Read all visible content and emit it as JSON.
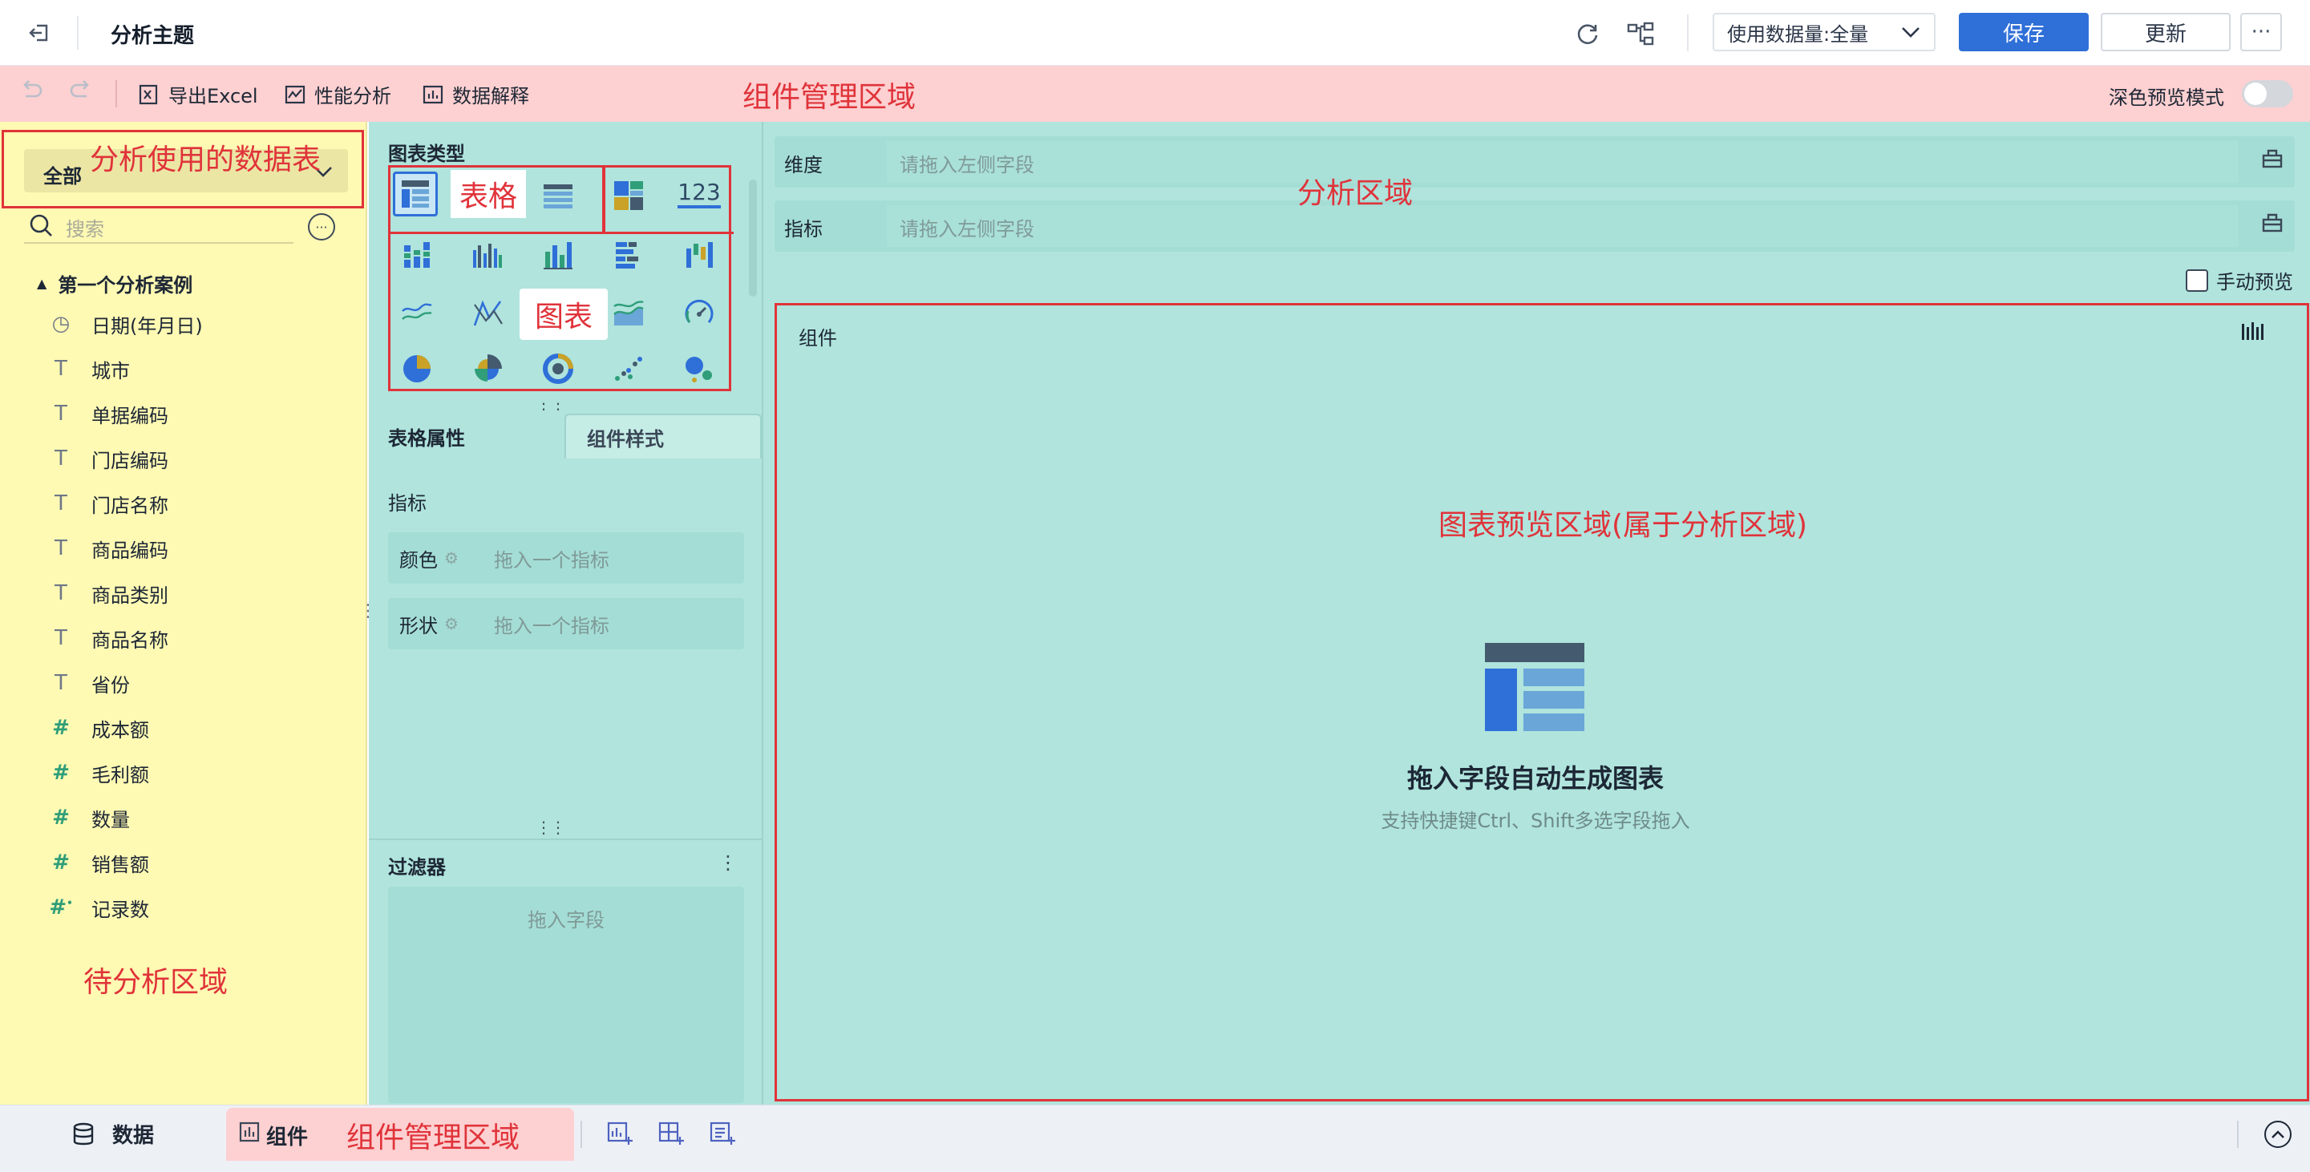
{
  "topbar": {
    "title": "分析主题",
    "data_amount_label": "使用数据量:全量",
    "save_label": "保存",
    "update_label": "更新",
    "more_label": "···"
  },
  "toolbar": {
    "export_label": "导出Excel",
    "performance_label": "性能分析",
    "explain_label": "数据解释",
    "annotation": "组件管理区域",
    "dark_mode_label": "深色预览模式"
  },
  "left": {
    "scope_label": "全部",
    "scope_annotation": "分析使用的数据表",
    "search_placeholder": "搜索",
    "group_label": "第一个分析案例",
    "fields": [
      {
        "icon": "clock",
        "label": "日期(年月日)"
      },
      {
        "icon": "text",
        "label": "城市"
      },
      {
        "icon": "text",
        "label": "单据编码"
      },
      {
        "icon": "text",
        "label": "门店编码"
      },
      {
        "icon": "text",
        "label": "门店名称"
      },
      {
        "icon": "text",
        "label": "商品编码"
      },
      {
        "icon": "text",
        "label": "商品类别"
      },
      {
        "icon": "text",
        "label": "商品名称"
      },
      {
        "icon": "text",
        "label": "省份"
      },
      {
        "icon": "number",
        "label": "成本额"
      },
      {
        "icon": "number",
        "label": "毛利额"
      },
      {
        "icon": "number",
        "label": "数量"
      },
      {
        "icon": "number",
        "label": "销售额"
      },
      {
        "icon": "number-calc",
        "label": "记录数"
      }
    ],
    "pending_annotation": "待分析区域"
  },
  "middle": {
    "chart_type_title": "图表类型",
    "table_annotation": "表格",
    "chart_annotation": "图表",
    "kpi_label": "123",
    "tabs": [
      "表格属性",
      "组件样式"
    ],
    "metric_label": "指标",
    "color_label": "颜色",
    "shape_label": "形状",
    "metric_placeholder": "拖入一个指标",
    "filter_title": "过滤器",
    "filter_menu": "⋮",
    "filter_placeholder": "拖入字段"
  },
  "analysis": {
    "dimension_label": "维度",
    "metric_label": "指标",
    "drop_placeholder": "请拖入左侧字段",
    "annotation": "分析区域",
    "manual_preview_label": "手动预览",
    "component_label": "组件",
    "preview_annotation": "图表预览区域(属于分析区域)",
    "empty_title": "拖入字段自动生成图表",
    "empty_subtitle": "支持快捷键Ctrl、Shift多选字段拖入"
  },
  "bottom": {
    "data_tab": "数据",
    "component_tab": "组件",
    "annotation": "组件管理区域"
  },
  "colors": {
    "primary": "#2f6fd8",
    "annotation_red": "#e0333a",
    "teal_area": "#b0e4dd",
    "yellow_area": "#fef9b3",
    "pink_area": "#fdd0d1"
  }
}
